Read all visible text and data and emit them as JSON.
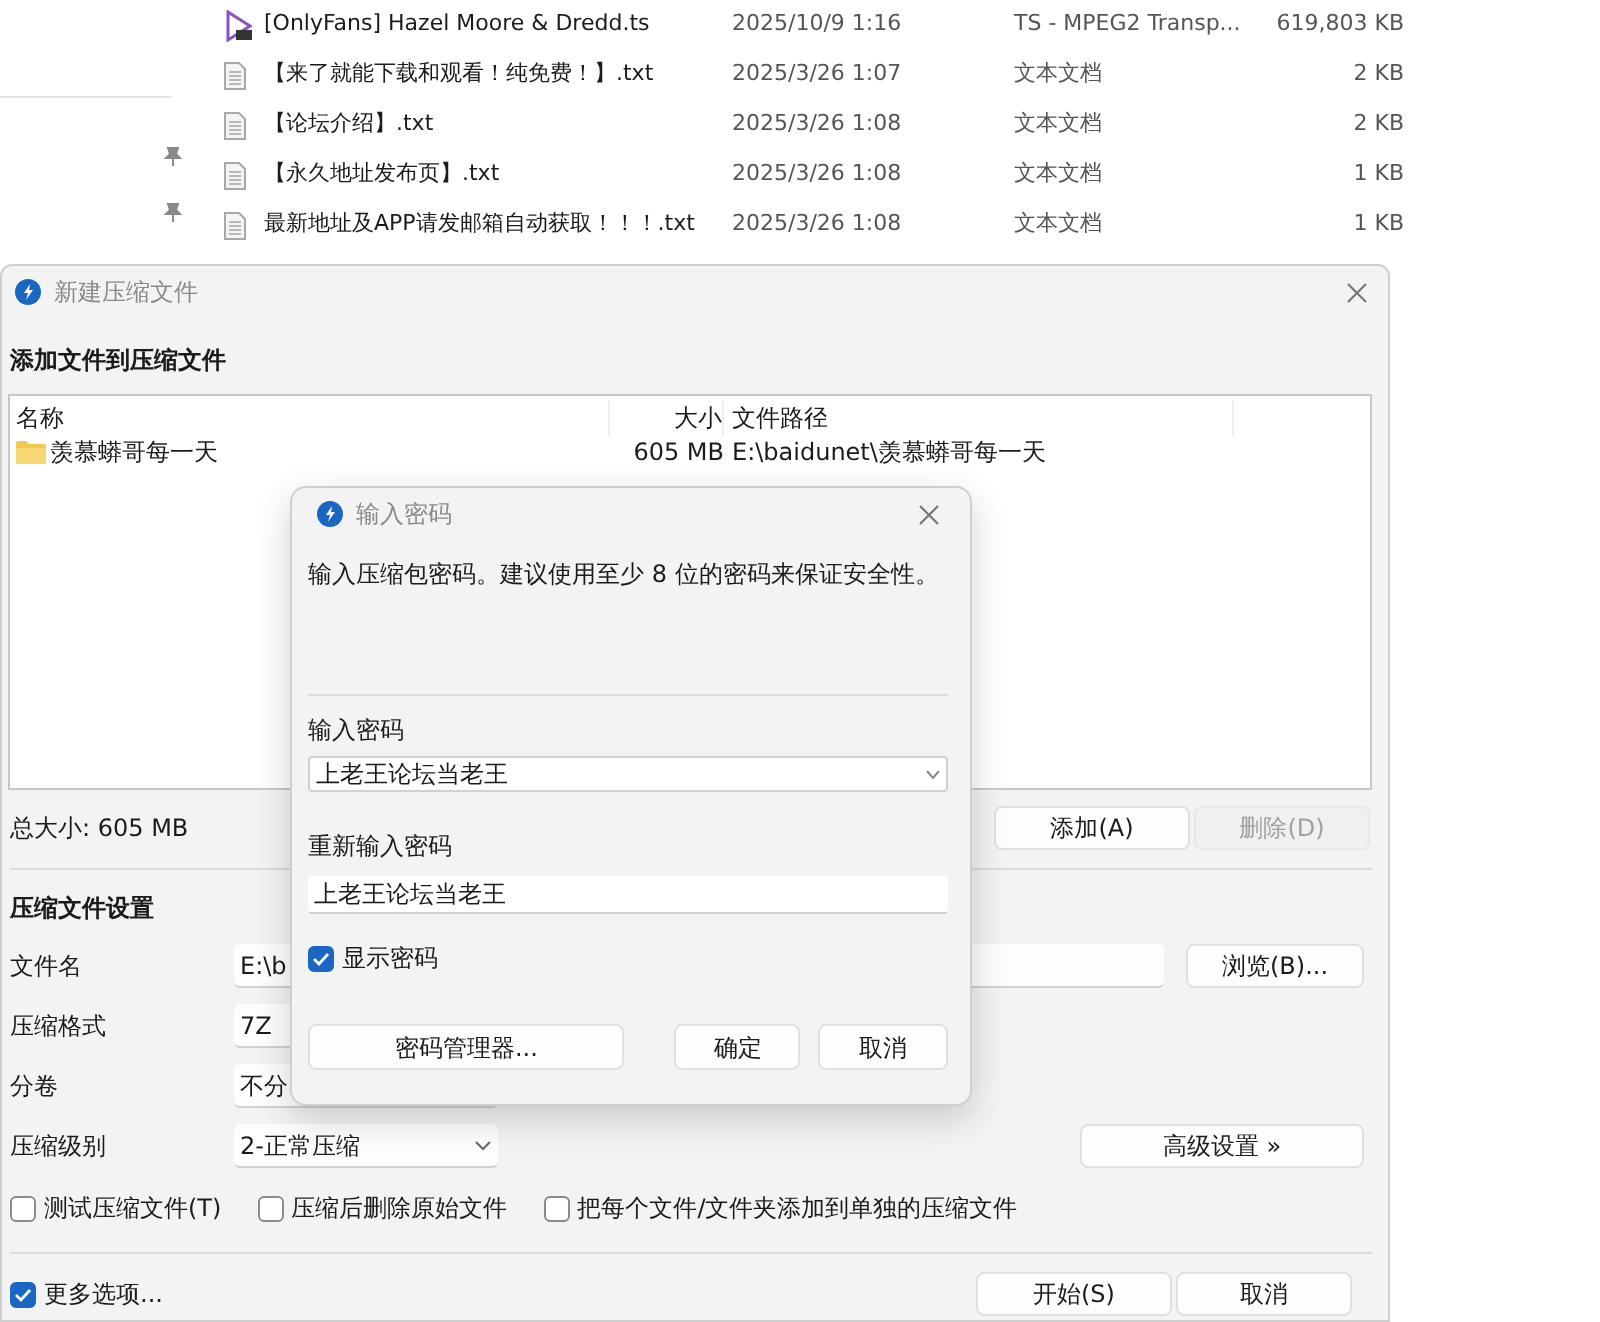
{
  "explorer": {
    "files": [
      {
        "kind": "video",
        "name": "[OnlyFans] Hazel Moore & Dredd.ts",
        "modified": "2025/10/9 1:16",
        "type": "TS - MPEG2 Transp...",
        "size": "619,803 KB"
      },
      {
        "kind": "text",
        "name": "【来了就能下载和观看！纯免费！】.txt",
        "modified": "2025/3/26 1:07",
        "type": "文本文档",
        "size": "2 KB"
      },
      {
        "kind": "text",
        "name": "【论坛介绍】.txt",
        "modified": "2025/3/26 1:08",
        "type": "文本文档",
        "size": "2 KB"
      },
      {
        "kind": "text",
        "name": "【永久地址发布页】.txt",
        "modified": "2025/3/26 1:08",
        "type": "文本文档",
        "size": "1 KB"
      },
      {
        "kind": "text",
        "name": "最新地址及APP请发邮箱自动获取！！！.txt",
        "modified": "2025/3/26 1:08",
        "type": "文本文档",
        "size": "1 KB"
      }
    ]
  },
  "archive_dialog": {
    "title": "新建压缩文件",
    "heading": "添加文件到压缩文件",
    "file_list": {
      "columns": [
        "名称",
        "大小",
        "文件路径"
      ],
      "rows": [
        {
          "name": "羡慕蟒哥每一天",
          "size": "605 MB",
          "path": "E:\\baidunet\\羡慕蟒哥每一天"
        }
      ]
    },
    "total_size": "总大小: 605 MB",
    "list_buttons": [
      {
        "label": "添加(A)",
        "disabled": false
      },
      {
        "label": "删除(D)",
        "disabled": true
      }
    ],
    "settings_heading": "压缩文件设置",
    "fields": [
      {
        "kind": "text",
        "label": "文件名",
        "value": "E:\\b"
      },
      {
        "kind": "select",
        "label": "压缩格式",
        "value": "7Z"
      },
      {
        "kind": "select",
        "label": "分卷",
        "value": "不分"
      },
      {
        "kind": "dropdown",
        "label": "压缩级别",
        "value": "2-正常压缩"
      }
    ],
    "browse_button": "浏览(B)...",
    "advanced_button": "高级设置 »",
    "options": [
      {
        "label": "测试压缩文件(T)",
        "checked": false
      },
      {
        "label": "压缩后删除原始文件",
        "checked": false
      },
      {
        "label": "把每个文件/文件夹添加到单独的压缩文件",
        "checked": false
      }
    ],
    "more_options": {
      "label": "更多选项...",
      "checked": true
    },
    "footer_buttons": [
      "开始(S)",
      "取消"
    ]
  },
  "password_dialog": {
    "title": "输入密码",
    "message": "输入压缩包密码。建议使用至少 8 位的密码来保证安全性。",
    "password_label": "输入密码",
    "password": "上老王论坛当老王",
    "confirm_label": "重新输入密码",
    "confirm_password": "上老王论坛当老王",
    "show_password": {
      "label": "显示密码",
      "checked": true
    },
    "buttons": [
      "密码管理器...",
      "确定",
      "取消"
    ]
  }
}
